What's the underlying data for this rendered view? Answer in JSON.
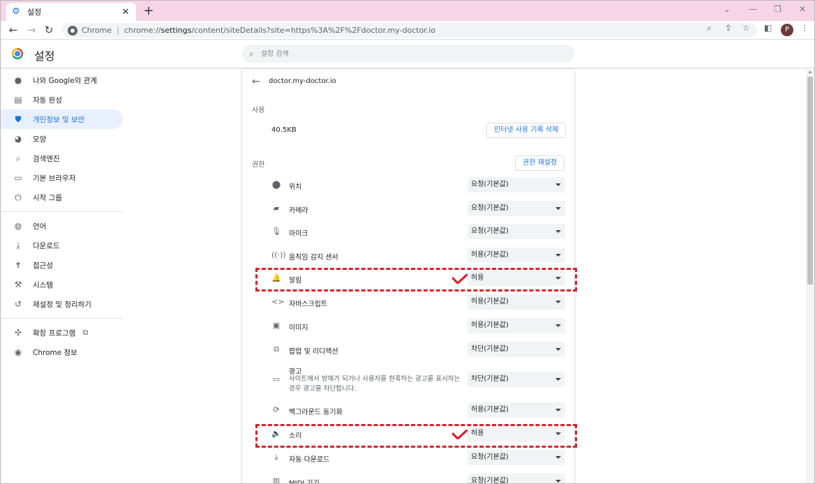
{
  "tab": {
    "title": "설정",
    "icon": "gear-icon"
  },
  "toolbar": {
    "origin": "Chrome",
    "url_prefix": "chrome://",
    "url_host": "settings",
    "url_path": "/content/siteDetails?site=https%3A%2F%2Fdoctor.my-doctor.io",
    "profile_initial": "P"
  },
  "header": {
    "title": "설정",
    "search_placeholder": "설정 검색"
  },
  "sidebar": {
    "items": [
      {
        "label": "나와 Google의 관계",
        "icon": "person-icon"
      },
      {
        "label": "자동 완성",
        "icon": "clipboard-icon"
      },
      {
        "label": "개인정보 및 보안",
        "icon": "shield-icon",
        "active": true
      },
      {
        "label": "모양",
        "icon": "palette-icon"
      },
      {
        "label": "검색엔진",
        "icon": "search-icon"
      },
      {
        "label": "기본 브라우저",
        "icon": "browser-icon"
      },
      {
        "label": "시작 그룹",
        "icon": "power-icon"
      }
    ],
    "items2": [
      {
        "label": "언어",
        "icon": "globe-icon"
      },
      {
        "label": "다운로드",
        "icon": "download-icon"
      },
      {
        "label": "접근성",
        "icon": "accessibility-icon"
      },
      {
        "label": "시스템",
        "icon": "wrench-icon"
      },
      {
        "label": "재설정 및 정리하기",
        "icon": "reset-icon"
      }
    ],
    "items3": [
      {
        "label": "확장 프로그램",
        "icon": "puzzle-icon"
      },
      {
        "label": "Chrome 정보",
        "icon": "chrome-icon"
      }
    ]
  },
  "site": {
    "name": "doctor.my-doctor.io",
    "usage_label": "사용",
    "usage_value": "40.5KB",
    "clear_button": "인터넷 사용 기록 삭제",
    "permissions_label": "권한",
    "reset_button": "권한 재설정"
  },
  "permissions": [
    {
      "label": "위치",
      "icon": "location-pin-icon",
      "value": "요청(기본값)"
    },
    {
      "label": "카메라",
      "icon": "camera-icon",
      "value": "요청(기본값)"
    },
    {
      "label": "마이크",
      "icon": "microphone-icon",
      "value": "요청(기본값)"
    },
    {
      "label": "움직임 감지 센서",
      "icon": "motion-sensor-icon",
      "value": "허용(기본값)"
    },
    {
      "label": "알림",
      "icon": "bell-icon",
      "value": "허용"
    },
    {
      "label": "자바스크립트",
      "icon": "code-icon",
      "value": "허용(기본값)"
    },
    {
      "label": "이미지",
      "icon": "image-icon",
      "value": "허용(기본값)"
    },
    {
      "label": "팝업 및 리디렉션",
      "icon": "popup-icon",
      "value": "차단(기본값)"
    },
    {
      "label": "광고",
      "icon": "ad-icon",
      "value": "차단(기본값)",
      "description": "사이트에서 방해가 되거나 사용자를 현혹하는 광고를 표시하는 경우 광고를 차단합니다."
    },
    {
      "label": "백그라운드 동기화",
      "icon": "sync-icon",
      "value": "허용(기본값)"
    },
    {
      "label": "소리",
      "icon": "speaker-icon",
      "value": "허용"
    },
    {
      "label": "자동 다운로드",
      "icon": "download-icon",
      "value": "요청(기본값)"
    },
    {
      "label": "MIDI 기기",
      "icon": "midi-icon",
      "value": "요청(기본값)"
    }
  ],
  "annotation_color": "#d9212c"
}
